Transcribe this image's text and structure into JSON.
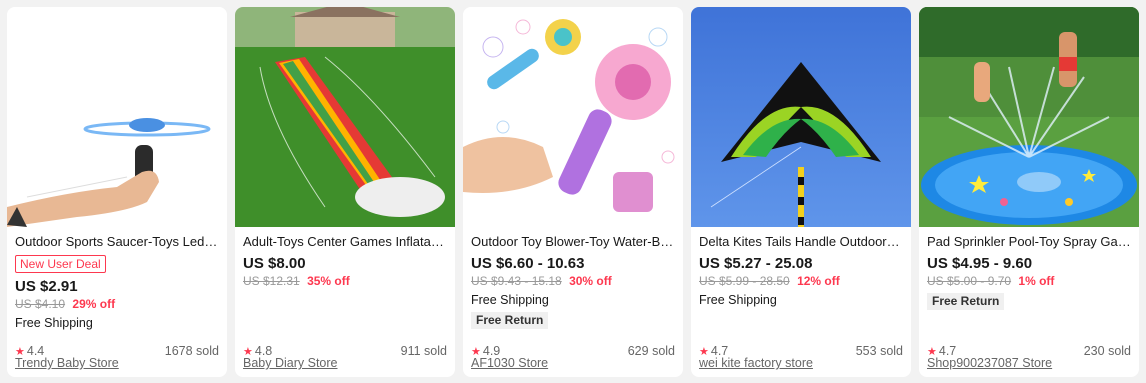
{
  "products": [
    {
      "title": "Outdoor Sports Saucer-Toys Led-Li...",
      "badge": "New User Deal",
      "price": "US $2.91",
      "old_price": "US $4.10",
      "discount": "29% off",
      "shipping": "Free Shipping",
      "rating": "4.4",
      "sold": "1678 sold",
      "store": "Trendy Baby Store",
      "image_icon": "flying-saucer-toy-image"
    },
    {
      "title": "Adult-Toys Center Games Inflatabl...",
      "price": "US $8.00",
      "old_price": "US $12.31",
      "discount": "35% off",
      "rating": "4.8",
      "sold": "911 sold",
      "store": "Baby Diary Store",
      "image_icon": "rainbow-water-slide-image"
    },
    {
      "title": "Outdoor Toy Blower-Toy Water-Bu...",
      "price": "US $6.60 - 10.63",
      "old_price": "US $9.43 - 15.18",
      "discount": "30% off",
      "shipping": "Free Shipping",
      "free_return": "Free Return",
      "rating": "4.9",
      "sold": "629 sold",
      "store": "AF1030 Store",
      "image_icon": "bubble-wand-image"
    },
    {
      "title": "Delta Kites Tails Handle Outdoor-T...",
      "price": "US $5.27 - 25.08",
      "old_price": "US $5.99 - 28.50",
      "discount": "12% off",
      "shipping": "Free Shipping",
      "rating": "4.7",
      "sold": "553 sold",
      "store": "wei kite factory store",
      "image_icon": "delta-kite-image"
    },
    {
      "title": "Pad Sprinkler Pool-Toy Spray Gam...",
      "price": "US $4.95 - 9.60",
      "old_price": "US $5.00 - 9.70",
      "discount": "1% off",
      "free_return": "Free Return",
      "rating": "4.7",
      "sold": "230 sold",
      "store": "Shop900237087 Store",
      "image_icon": "sprinkler-pad-image"
    }
  ],
  "colors": {
    "accent": "#fd384f",
    "background": "#f2f2f2",
    "card": "#ffffff",
    "muted": "#999999"
  },
  "star_glyph": "★"
}
